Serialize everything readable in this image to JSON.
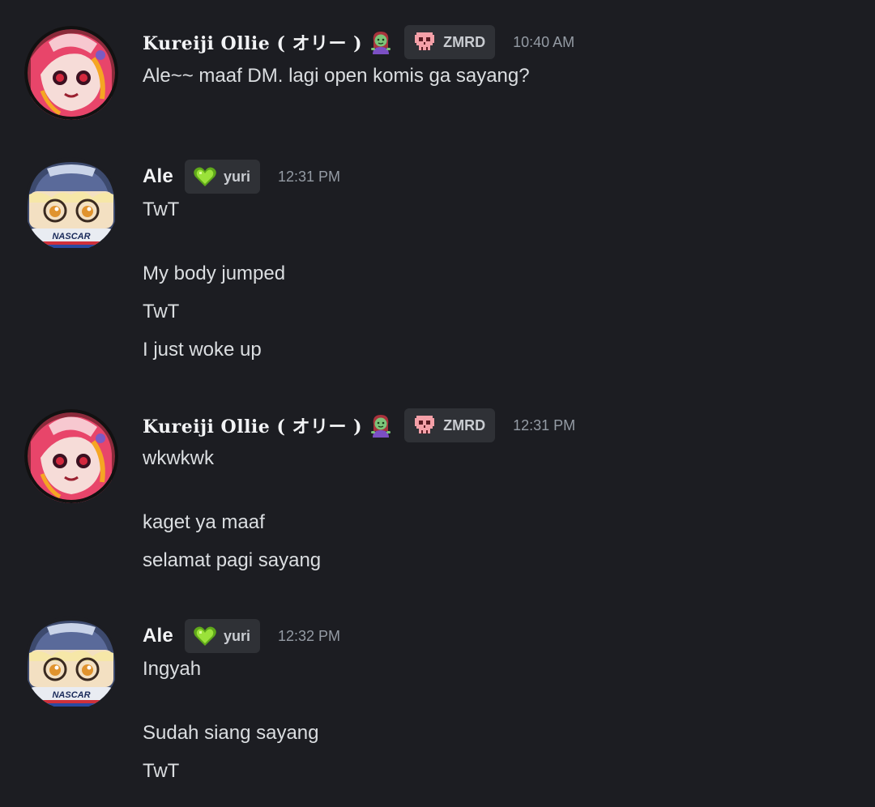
{
  "messages": [
    {
      "author": "Kureiji Ollie ( オリー )",
      "author_emoji": "woman-zombie-icon",
      "role": "ZMRD",
      "role_icon": "skull-icon",
      "timestamp": "10:40 AM",
      "lines": [
        "Ale~~ maaf DM. lagi open komis ga sayang?"
      ]
    },
    {
      "author": "Ale",
      "role": "yuri",
      "role_icon": "green-heart-icon",
      "timestamp": "12:31 PM",
      "lines": [
        "TwT",
        "My body jumped",
        "TwT",
        "I just woke up"
      ]
    },
    {
      "author": "Kureiji Ollie ( オリー )",
      "author_emoji": "woman-zombie-icon",
      "role": "ZMRD",
      "role_icon": "skull-icon",
      "timestamp": "12:31 PM",
      "lines": [
        "wkwkwk",
        "kaget ya maaf",
        "selamat pagi sayang"
      ]
    },
    {
      "author": "Ale",
      "role": "yuri",
      "role_icon": "green-heart-icon",
      "timestamp": "12:32 PM",
      "lines": [
        "Ingyah",
        "Sudah siang sayang",
        "TwT"
      ]
    }
  ],
  "avatar_text": "NASCAR",
  "colors": {
    "background": "#1c1d22",
    "role_tag_bg": "#2f3136",
    "timestamp": "#949ba4",
    "text": "#dbdee1",
    "yuri_heart": "#7ed321",
    "skull": "#f4a0a8"
  }
}
